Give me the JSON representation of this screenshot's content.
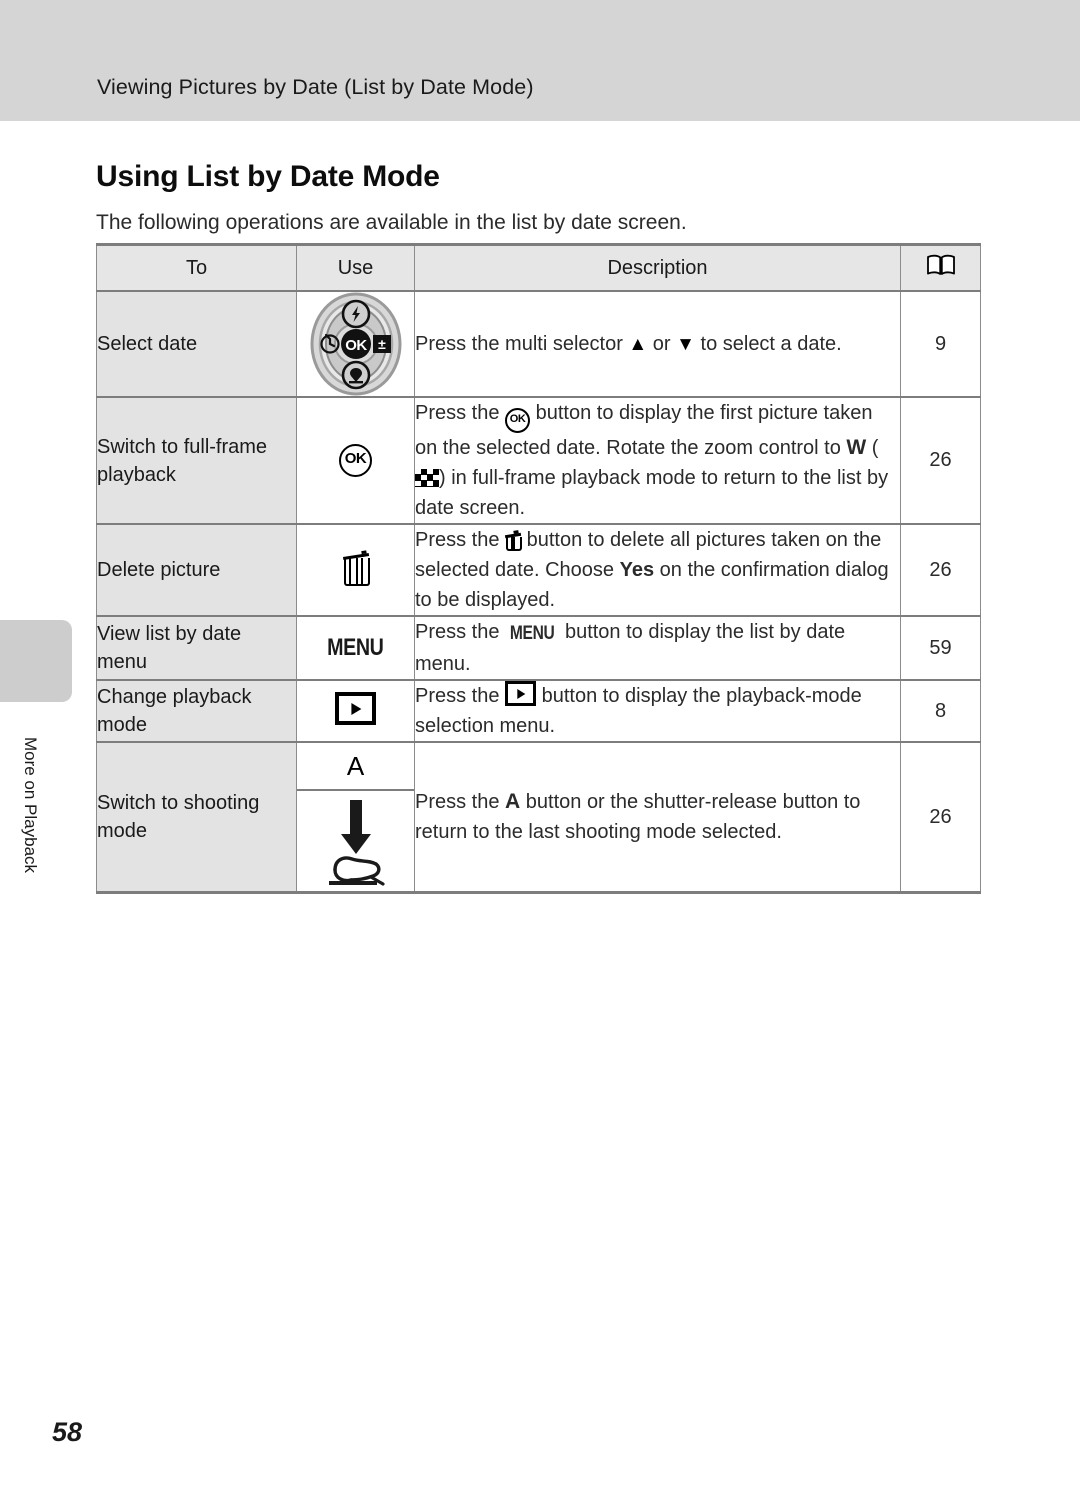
{
  "header": {
    "running_title": "Viewing Pictures by Date (List by Date Mode)"
  },
  "side_tab": {
    "label": "More on Playback"
  },
  "section": {
    "heading": "Using List by Date Mode",
    "intro": "The following operations are available in the list by date screen."
  },
  "table": {
    "columns": {
      "to": "To",
      "use": "Use",
      "description": "Description",
      "reference": "book-icon"
    },
    "rows": [
      {
        "to": "Select date",
        "use_icon": "multi-selector-dial",
        "description_before": "Press the multi selector ",
        "description_mid": " or ",
        "description_after": " to select a date.",
        "up_glyph": "▲",
        "down_glyph": "▼",
        "reference": "9"
      },
      {
        "to": "Switch to full-frame playback",
        "use_icon": "ok-button",
        "use_label": "OK",
        "line1_before": "Press the ",
        "line1_after": " button to display the first picture taken on the selected date.",
        "line2_before": "Rotate the zoom control to ",
        "line2_w": "W",
        "line2_mid": " (",
        "line2_after": ") in full-frame playback mode to return to the list by date screen.",
        "reference": "26"
      },
      {
        "to": "Delete picture",
        "use_icon": "trash-button",
        "description_before": "Press the ",
        "description_mid": " button to delete all pictures taken on the selected date. Choose ",
        "description_emphasis": "Yes",
        "description_after": " on the confirmation dialog to be displayed.",
        "reference": "26"
      },
      {
        "to": "View list by date menu",
        "use_icon": "menu-button",
        "use_label": "MENU",
        "description_before": "Press the ",
        "description_mid": "MENU",
        "description_after": " button to display the list by date menu.",
        "reference": "59"
      },
      {
        "to": "Change playback mode",
        "use_icon": "playback-button",
        "description_before": "Press the ",
        "description_after": " button to display the playback-mode selection menu.",
        "reference": "8"
      },
      {
        "to": "Switch to shooting mode",
        "use_icon_top": "a-button",
        "use_label_top": "A",
        "use_icon_bottom": "shutter-release-press",
        "description_before": "Press the ",
        "description_mid": "A",
        "description_after": "  button or the shutter-release button to return to the last shooting mode selected.",
        "reference": "26"
      }
    ]
  },
  "footer": {
    "page_number": "58"
  },
  "colors": {
    "header_band": "#d5d5d5",
    "side_tab": "#cdcdcd",
    "table_head": "#e6e6e6",
    "first_column": "#e3e3e3",
    "rule": "#7d7d7d"
  }
}
